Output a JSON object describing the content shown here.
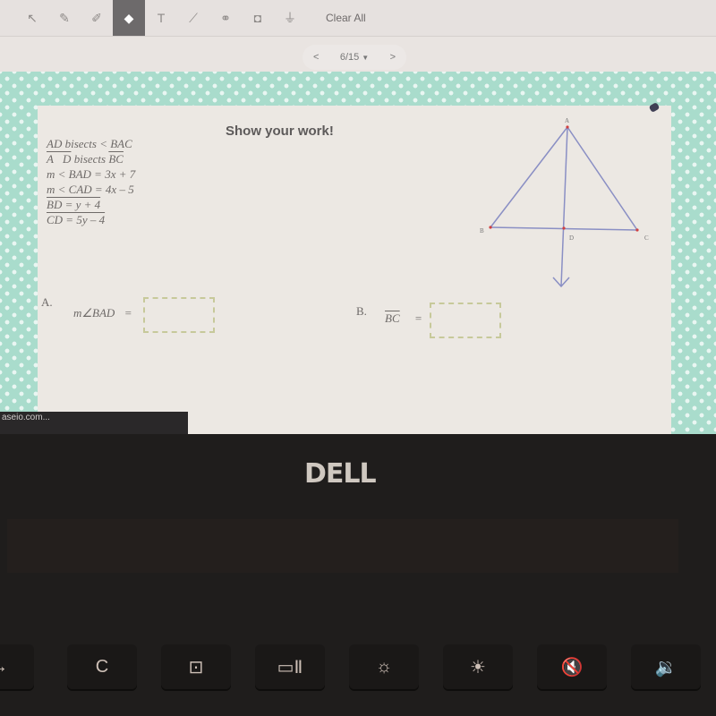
{
  "toolbar": {
    "tools": [
      {
        "name": "select-tool",
        "icon": "↖"
      },
      {
        "name": "pen-tool",
        "icon": "✎"
      },
      {
        "name": "highlighter-tool",
        "icon": "✐"
      },
      {
        "name": "eraser-tool",
        "icon": "◆",
        "active": true
      },
      {
        "name": "text-tool",
        "icon": "T"
      },
      {
        "name": "line-tool",
        "icon": "⟋"
      },
      {
        "name": "link-tool",
        "icon": "⚭"
      },
      {
        "name": "camera-tool",
        "icon": "◘"
      },
      {
        "name": "microphone-tool",
        "icon": "⏚"
      }
    ],
    "clear_all": "Clear All"
  },
  "pager": {
    "prev": "<",
    "current": "6/15",
    "caret": "▼",
    "next": ">"
  },
  "question": {
    "heading": "Show your work!",
    "givens": [
      "AD bisects < BAC",
      "AD bisects BC",
      "m < BAD = 3x + 7",
      "m < CAD = 4x – 5",
      "BD = y + 4",
      "CD = 5y – 4"
    ],
    "diagram_labels": {
      "A": "A",
      "B": "B",
      "C": "C",
      "D": "D"
    },
    "part_a": {
      "label": "A.",
      "expr": "m∠BAD",
      "equals": "=",
      "value": ""
    },
    "part_b": {
      "label": "B.",
      "expr": "BC",
      "equals": "=",
      "value": ""
    }
  },
  "status_bar": {
    "text": "aseio.com..."
  },
  "laptop": {
    "brand": "DELL",
    "keys": [
      "→",
      "C",
      "⊡",
      "▭Ⅱ",
      "☼",
      "☀",
      "🔇",
      "🔉"
    ]
  },
  "colors": {
    "frame_teal": "#a9dccc",
    "card_bg": "#ece8e3",
    "answer_border": "#c7c99a",
    "active_tool": "#6d6a6b",
    "diagram_line": "#8a8fc4",
    "diagram_point": "#d04040"
  }
}
